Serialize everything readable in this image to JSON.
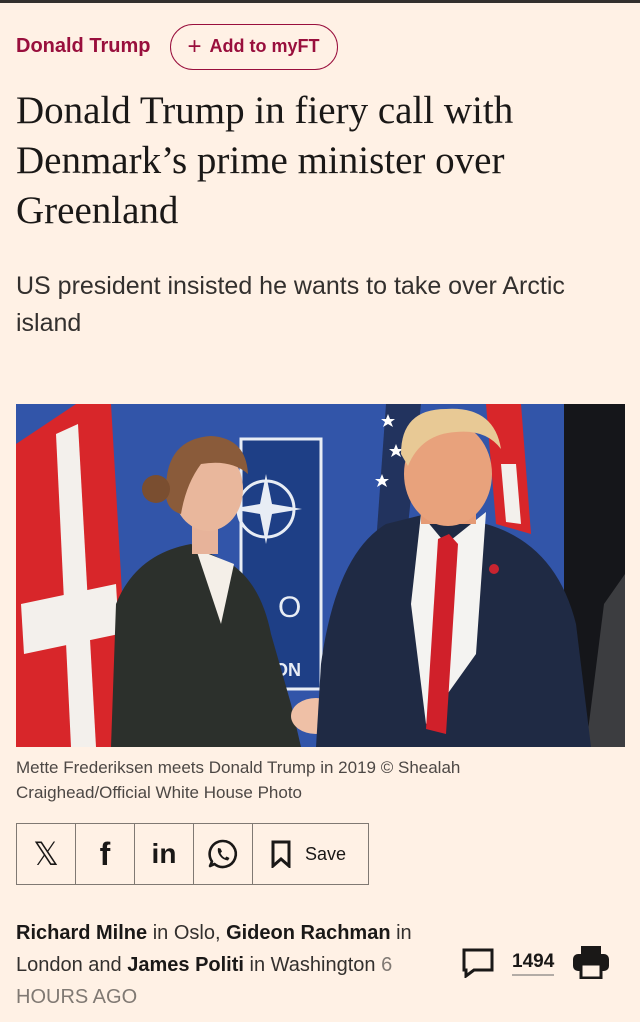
{
  "topic": {
    "label": "Donald Trump",
    "myft_plus": "+",
    "myft_label": "Add to myFT"
  },
  "article": {
    "headline": "Donald Trump in fiery call with Denmark’s prime minister over Greenland",
    "standfirst": "US president insisted he wants to take over Arctic island",
    "caption": "Mette Frederiksen meets Donald Trump in 2019 © Shealah Craighead/Official White House Photo"
  },
  "share": {
    "x_label": "𝕏",
    "facebook_label": "f",
    "linkedin_label": "in",
    "save_label": "Save"
  },
  "byline": {
    "author1": "Richard Milne",
    "loc1": " in Oslo, ",
    "author2": "Gideon Rachman",
    "loc2": " in London and ",
    "author3": "James Politi",
    "loc3": " in Washington ",
    "time": "6 HOURS AGO"
  },
  "comments": {
    "count": "1494"
  },
  "photo_text": {
    "banner_letters": "O",
    "banner_letters2": "ON"
  },
  "colors": {
    "background": "#fff1e5",
    "accent": "#990f3d",
    "text": "#33302e"
  },
  "icons": [
    "x-icon",
    "facebook-icon",
    "linkedin-icon",
    "whatsapp-icon",
    "bookmark-icon",
    "comment-icon",
    "print-icon"
  ]
}
